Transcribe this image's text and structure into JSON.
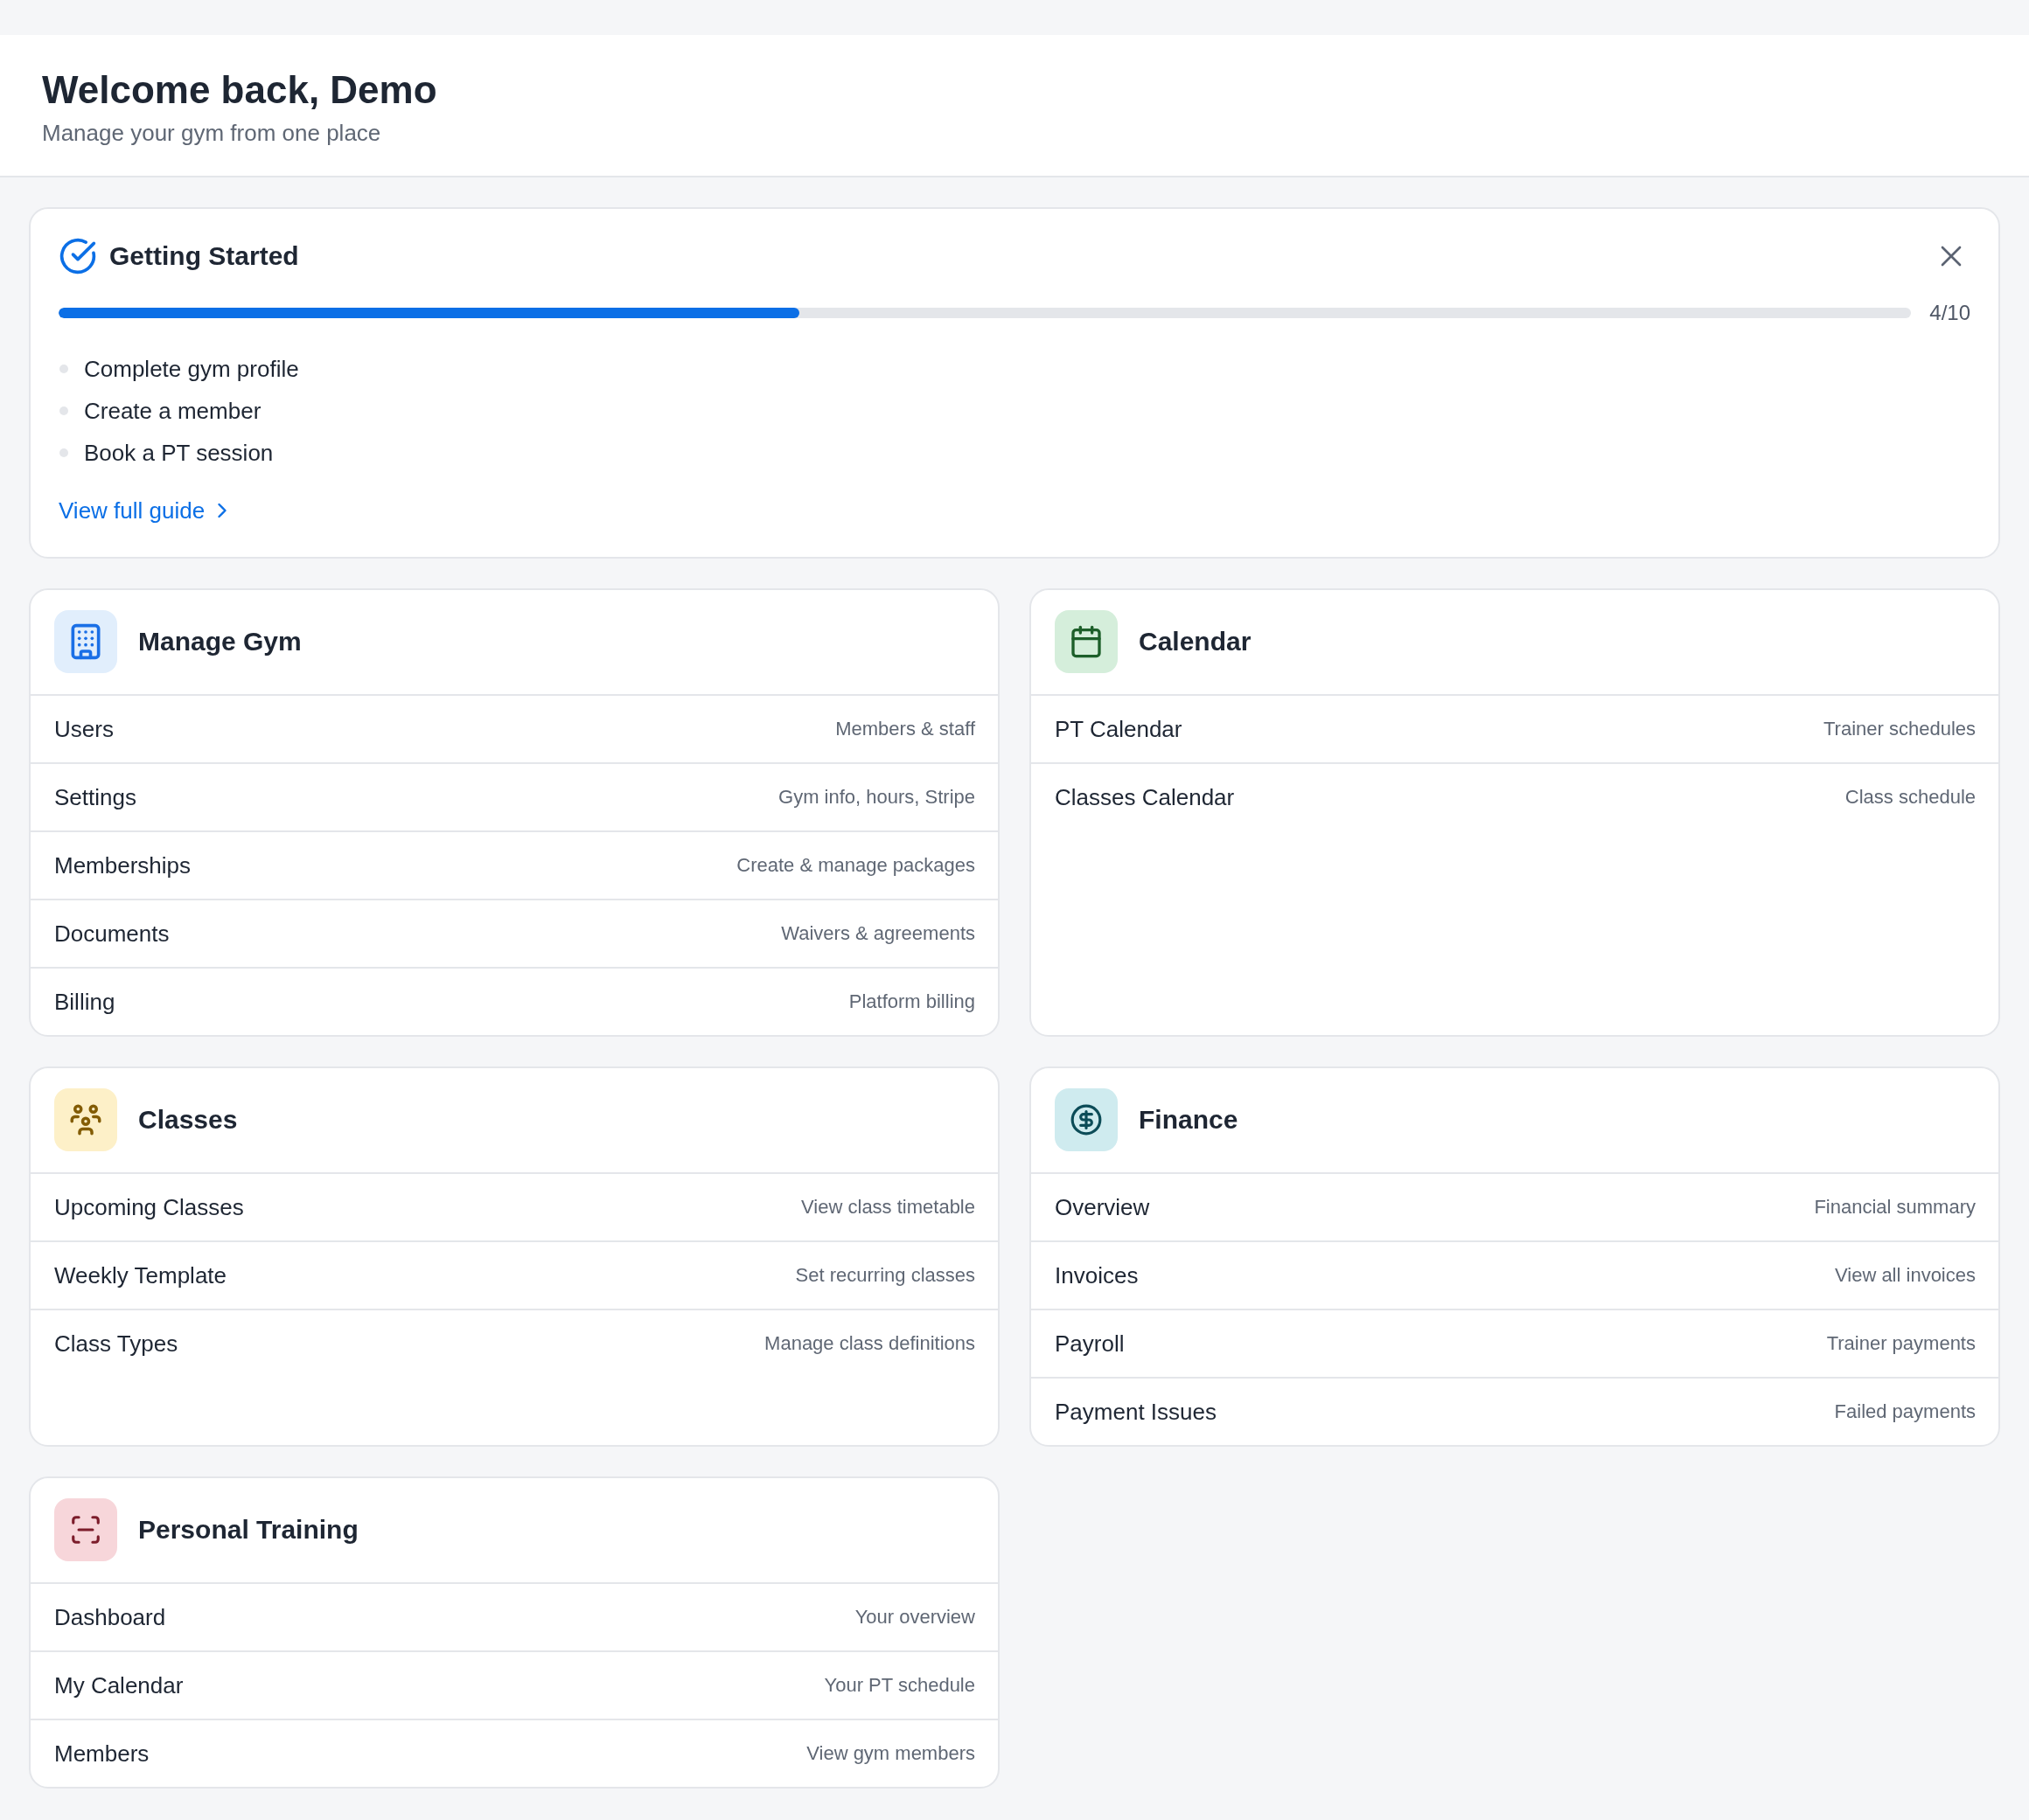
{
  "header": {
    "title": "Welcome back, Demo",
    "subtitle": "Manage your gym from one place"
  },
  "getting_started": {
    "title": "Getting Started",
    "progress": {
      "level": 0.4,
      "reading": "4/10"
    },
    "tasks": [
      "Complete gym profile",
      "Create a member",
      "Book a PT session"
    ],
    "link": "View full guide"
  },
  "sections": [
    {
      "title": "Manage Gym",
      "color": "#e1eefc",
      "items": [
        {
          "label": "Users",
          "description": "Members & staff"
        },
        {
          "label": "Settings",
          "description": "Gym info, hours, Stripe"
        },
        {
          "label": "Memberships",
          "description": "Create & manage packages"
        },
        {
          "label": "Documents",
          "description": "Waivers & agreements"
        },
        {
          "label": "Billing",
          "description": "Platform billing"
        }
      ]
    },
    {
      "title": "Calendar",
      "color": "#d5eedb",
      "items": [
        {
          "label": "PT Calendar",
          "description": "Trainer schedules"
        },
        {
          "label": "Classes Calendar",
          "description": "Class schedule"
        }
      ]
    },
    {
      "title": "Classes",
      "color": "#fdf0c8",
      "items": [
        {
          "label": "Upcoming Classes",
          "description": "View class timetable"
        },
        {
          "label": "Weekly Template",
          "description": "Set recurring classes"
        },
        {
          "label": "Class Types",
          "description": "Manage class definitions"
        }
      ]
    },
    {
      "title": "Finance",
      "color": "#cfebef",
      "items": [
        {
          "label": "Overview",
          "description": "Financial summary"
        },
        {
          "label": "Invoices",
          "description": "View all invoices"
        },
        {
          "label": "Payroll",
          "description": "Trainer payments"
        },
        {
          "label": "Payment Issues",
          "description": "Failed payments"
        }
      ]
    },
    {
      "title": "Personal Training",
      "color": "#f7d6da",
      "items": [
        {
          "label": "Dashboard",
          "description": "Your overview"
        },
        {
          "label": "My Calendar",
          "description": "Your PT schedule"
        },
        {
          "label": "Members",
          "description": "View gym members"
        }
      ]
    }
  ]
}
